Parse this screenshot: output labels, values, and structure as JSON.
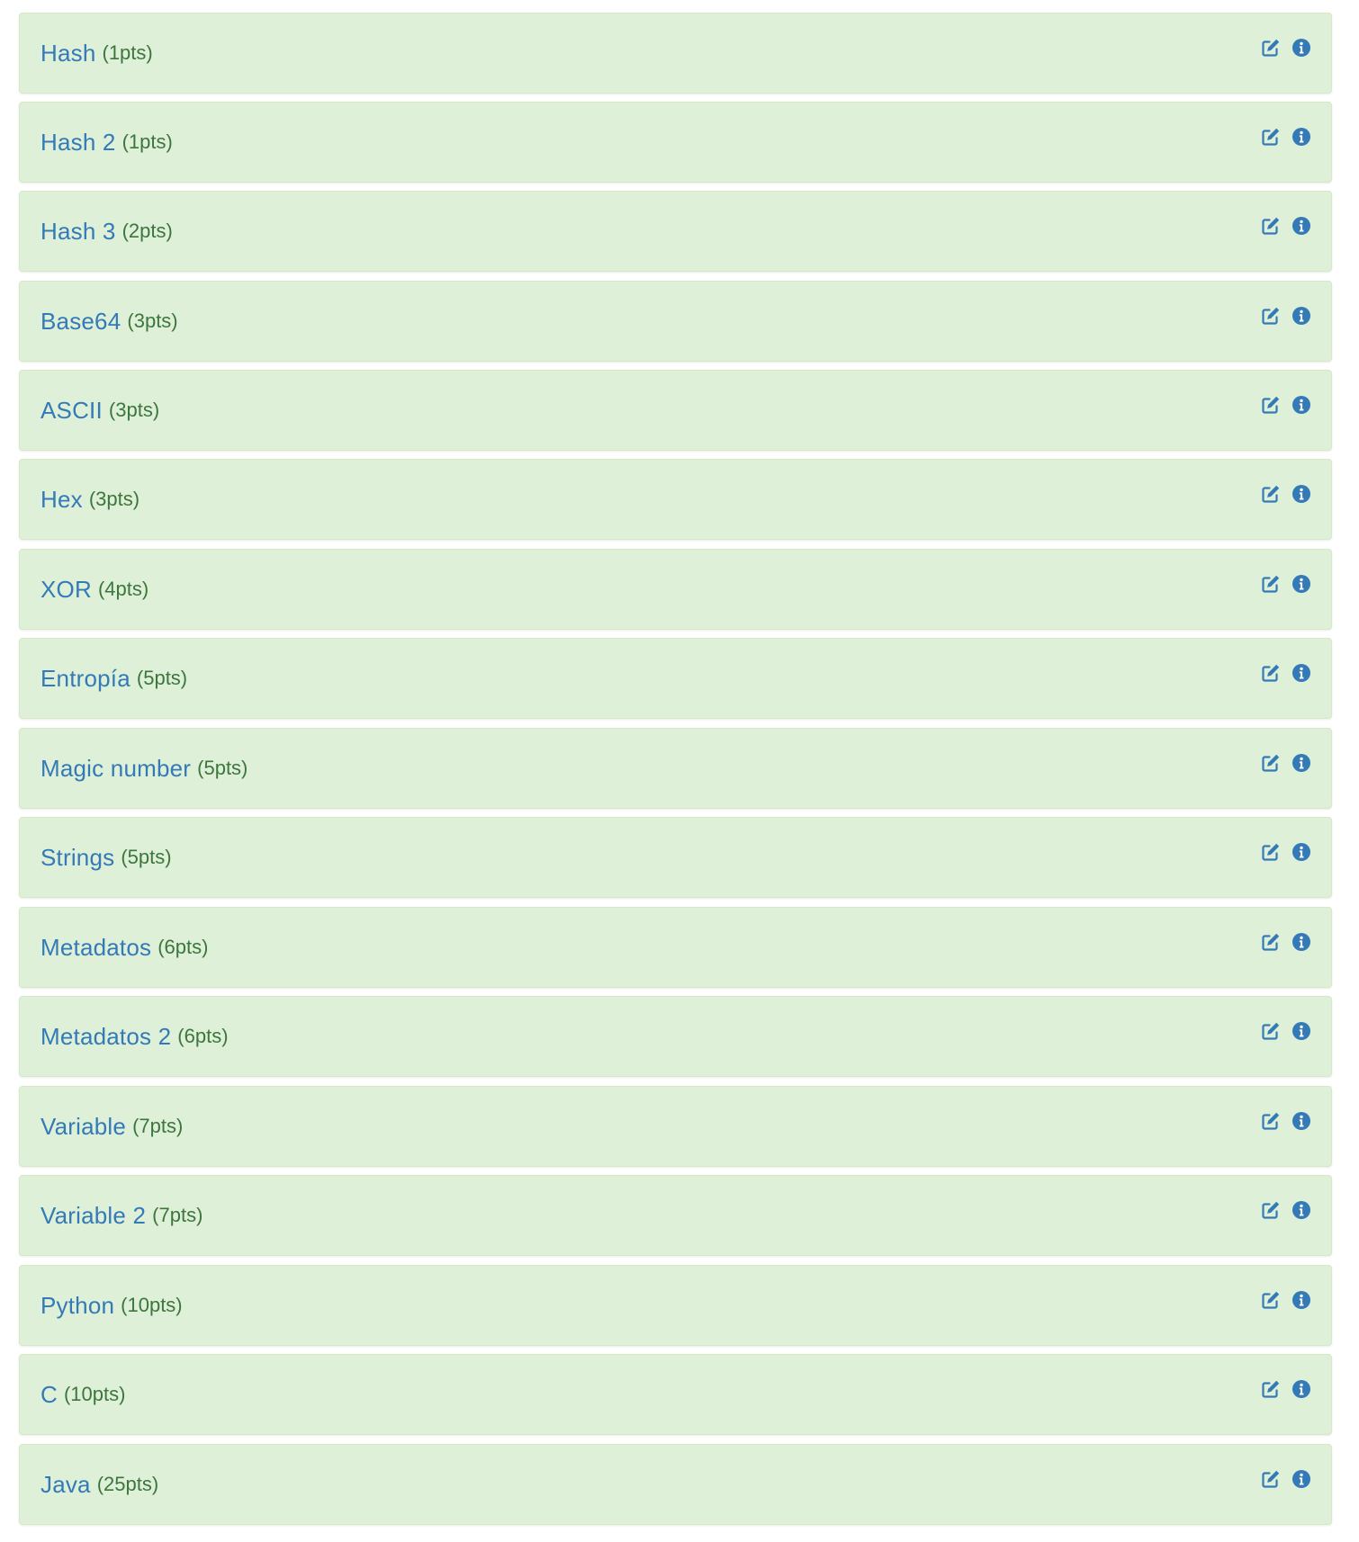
{
  "colors": {
    "panel_background": "#dff0d8",
    "panel_border": "#d6e9c6",
    "title_text": "#337ab7",
    "points_text": "#3c763d",
    "icon": "#337ab7"
  },
  "icons": {
    "edit": "edit-icon",
    "info": "info-icon"
  },
  "challenges": [
    {
      "name": "Hash",
      "points": "(1pts)"
    },
    {
      "name": "Hash 2",
      "points": "(1pts)"
    },
    {
      "name": "Hash 3",
      "points": "(2pts)"
    },
    {
      "name": "Base64",
      "points": "(3pts)"
    },
    {
      "name": "ASCII",
      "points": "(3pts)"
    },
    {
      "name": "Hex",
      "points": "(3pts)"
    },
    {
      "name": "XOR",
      "points": "(4pts)"
    },
    {
      "name": "Entropía",
      "points": "(5pts)"
    },
    {
      "name": "Magic number",
      "points": "(5pts)"
    },
    {
      "name": "Strings",
      "points": "(5pts)"
    },
    {
      "name": "Metadatos",
      "points": "(6pts)"
    },
    {
      "name": "Metadatos 2",
      "points": "(6pts)"
    },
    {
      "name": "Variable",
      "points": "(7pts)"
    },
    {
      "name": "Variable 2",
      "points": "(7pts)"
    },
    {
      "name": "Python",
      "points": "(10pts)"
    },
    {
      "name": "C",
      "points": "(10pts)"
    },
    {
      "name": "Java",
      "points": "(25pts)"
    }
  ]
}
